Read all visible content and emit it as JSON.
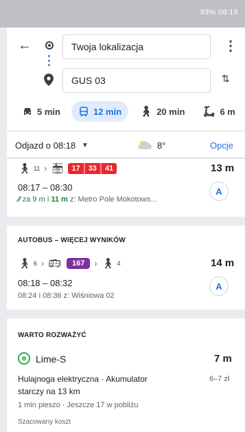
{
  "status_bar": {
    "text": "93% 08:16"
  },
  "search": {
    "origin": "Twoja lokalizacja",
    "destination": "GUS 03"
  },
  "modes": [
    {
      "icon": "car-icon",
      "label": "5 min"
    },
    {
      "icon": "bus-icon",
      "label": "12 min",
      "active": true
    },
    {
      "icon": "walk-icon",
      "label": "20 min"
    },
    {
      "icon": "bike-icon",
      "label": "6 m"
    }
  ],
  "subheader": {
    "departure": "Odjazd o 08:18",
    "temperature": "8°",
    "options_label": "Opcje"
  },
  "route1": {
    "walk_minutes": "11",
    "lines": [
      "17",
      "33",
      "41"
    ],
    "duration": "13 m",
    "time_range": "08:17 – 08:30",
    "realtime_prefix": "za 9 m i",
    "realtime_next": "11 m",
    "stop": "z: Metro Pole Mokotows..."
  },
  "section_bus": {
    "title": "AUTOBUS – WIĘCEJ WYNIKÓW",
    "walk_before": "6",
    "line": "167",
    "walk_after": "4",
    "duration": "14 m",
    "time_range": "08:18 – 08:32",
    "alternatives": "08:24 i 08:36 z: Wiśniowa 02"
  },
  "section_consider": {
    "title": "WARTO ROZWAŻYĆ",
    "provider": "Lime-S",
    "duration": "7 m",
    "description_line1": "Hulajnoga elektryczna · Akumulator",
    "description_line2": "starczy na 13 km",
    "price": "6–7 zł",
    "walk_info": "1 min pieszo · Jeszcze 17 w pobliżu",
    "cost_note": "Szacowany koszt"
  },
  "colors": {
    "accent": "#1a73e8",
    "tram_badge": "#e8282c",
    "bus_badge": "#7b2fa0",
    "realtime_green": "#188038"
  }
}
